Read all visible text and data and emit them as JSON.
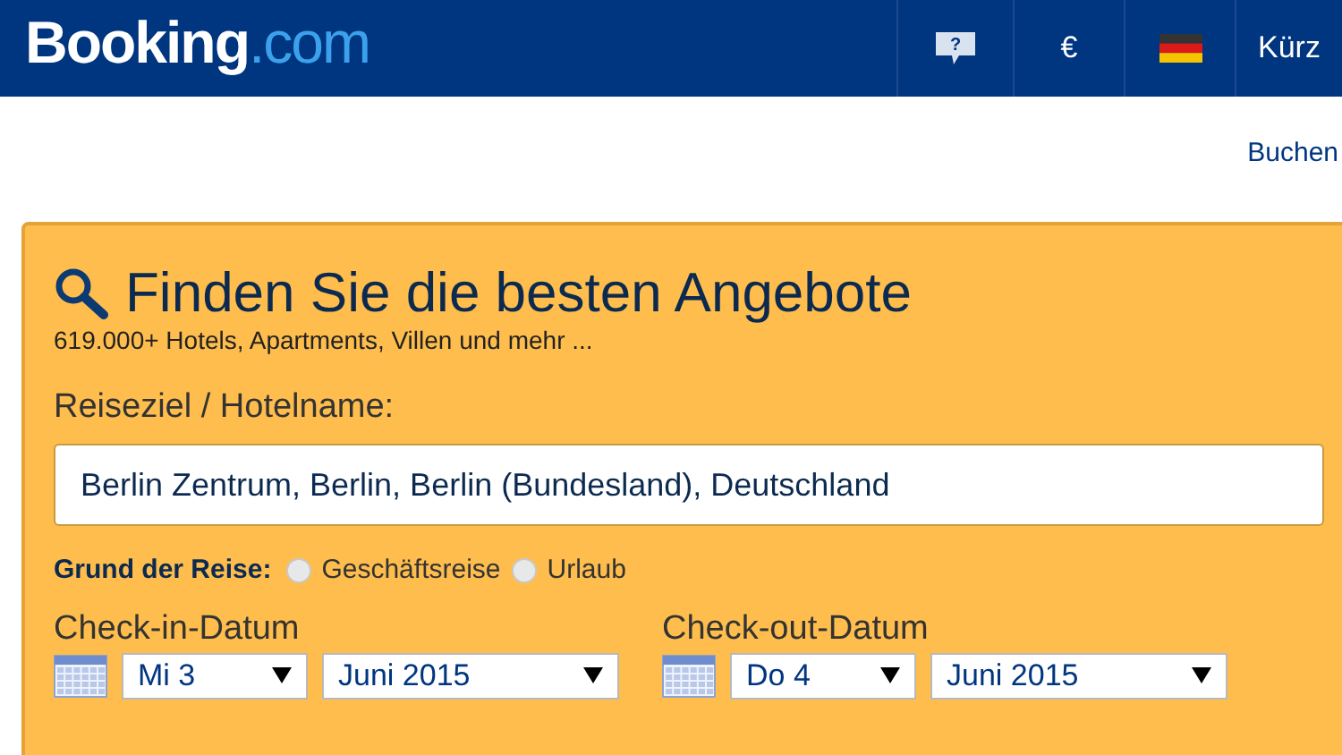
{
  "header": {
    "logo": {
      "name": "Booking",
      "suffix": ".com"
    },
    "nav": [
      {
        "kind": "help",
        "label": "?"
      },
      {
        "kind": "text",
        "label": "€"
      },
      {
        "kind": "flag"
      },
      {
        "kind": "text",
        "label": "Kürz"
      }
    ]
  },
  "top_link": "Buchen",
  "search": {
    "title": "Finden Sie die besten Angebote",
    "subtitle": "619.000+ Hotels, Apartments, Villen und mehr ...",
    "destination_label": "Reiseziel / Hotelname:",
    "destination_value": "Berlin Zentrum, Berlin, Berlin (Bundesland), Deutschland",
    "reason_label": "Grund der Reise:",
    "reasons": [
      {
        "label": "Geschäftsreise",
        "selected": false
      },
      {
        "label": "Urlaub",
        "selected": false
      }
    ],
    "dates": [
      {
        "label": "Check-in-Datum",
        "day": "Mi 3",
        "month": "Juni 2015"
      },
      {
        "label": "Check-out-Datum",
        "day": "Do 4",
        "month": "Juni 2015"
      }
    ]
  }
}
